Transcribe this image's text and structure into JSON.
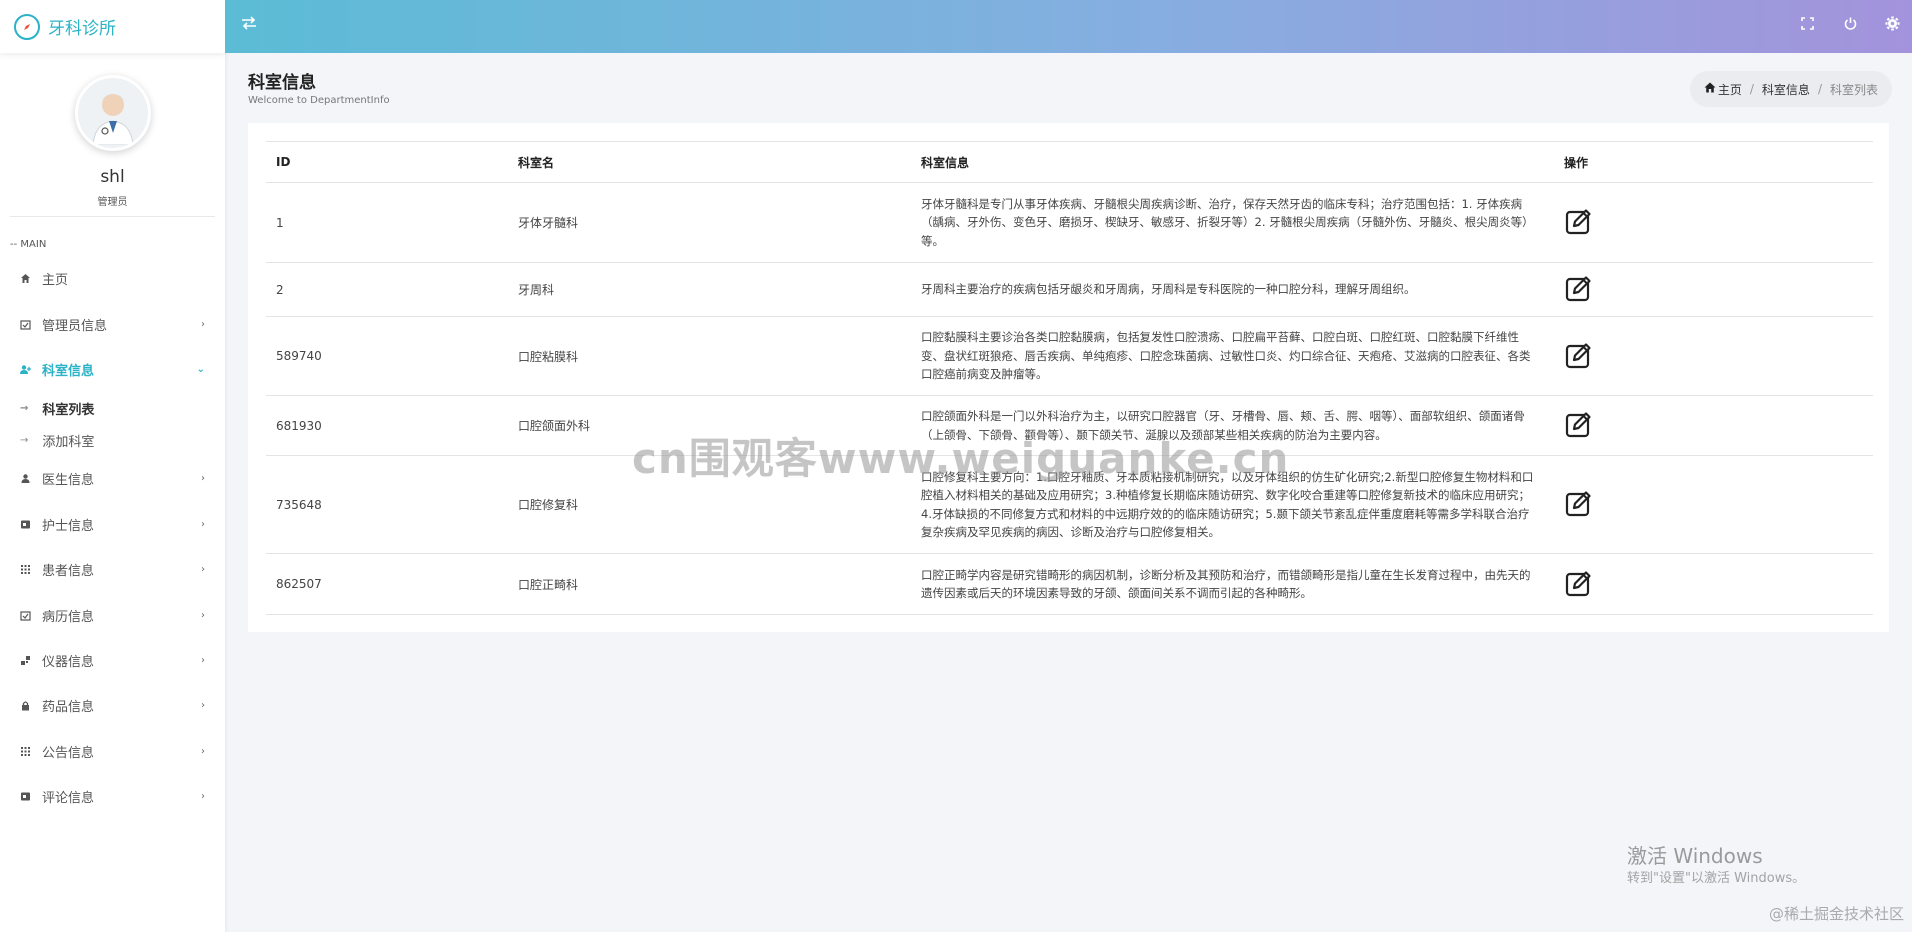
{
  "sidebar": {
    "app_name": "牙科诊所",
    "user_name": "shl",
    "user_role": "管理员",
    "section_label": "-- MAIN",
    "items": [
      {
        "label": "主页",
        "icon": "home-icon",
        "has_chevron": false
      },
      {
        "label": "管理员信息",
        "icon": "calendar-check-icon",
        "has_chevron": true
      },
      {
        "label": "科室信息",
        "icon": "user-plus-icon",
        "has_chevron": true,
        "active": true
      },
      {
        "label": "医生信息",
        "icon": "user-icon",
        "has_chevron": true
      },
      {
        "label": "护士信息",
        "icon": "id-card-icon",
        "has_chevron": true
      },
      {
        "label": "患者信息",
        "icon": "grid-icon",
        "has_chevron": true
      },
      {
        "label": "病历信息",
        "icon": "calendar-check-icon",
        "has_chevron": true
      },
      {
        "label": "仪器信息",
        "icon": "blocks-icon",
        "has_chevron": true
      },
      {
        "label": "药品信息",
        "icon": "lock-icon",
        "has_chevron": true
      },
      {
        "label": "公告信息",
        "icon": "grid-icon",
        "has_chevron": true
      },
      {
        "label": "评论信息",
        "icon": "id-card-icon",
        "has_chevron": true
      }
    ],
    "sub_items": [
      "科室列表",
      "添加科室"
    ]
  },
  "page": {
    "title": "科室信息",
    "subtitle": "Welcome to DepartmentInfo"
  },
  "breadcrumb": {
    "home": "主页",
    "parent": "科室信息",
    "current": "科室列表"
  },
  "table": {
    "columns": [
      "ID",
      "科室名",
      "科室信息",
      "操作"
    ],
    "rows": [
      {
        "id": "1",
        "name": "牙体牙髓科",
        "info": "牙体牙髓科是专门从事牙体疾病、牙髓根尖周疾病诊断、治疗，保存天然牙齿的临床专科；治疗范围包括：1. 牙体疾病（龋病、牙外伤、变色牙、磨损牙、楔缺牙、敏感牙、折裂牙等）2. 牙髓根尖周疾病（牙髓外伤、牙髓炎、根尖周炎等）等。"
      },
      {
        "id": "2",
        "name": "牙周科",
        "info": "牙周科主要治疗的疾病包括牙龈炎和牙周病，牙周科是专科医院的一种口腔分科，理解牙周组织。"
      },
      {
        "id": "589740",
        "name": "口腔粘膜科",
        "info": "口腔黏膜科主要诊治各类口腔黏膜病，包括复发性口腔溃疡、口腔扁平苔藓、口腔白斑、口腔红斑、口腔黏膜下纤维性变、盘状红斑狼疮、唇舌疾病、单纯疱疹、口腔念珠菌病、过敏性口炎、灼口综合征、天疱疮、艾滋病的口腔表征、各类口腔癌前病变及肿瘤等。"
      },
      {
        "id": "681930",
        "name": "口腔颌面外科",
        "info": "口腔颌面外科是一门以外科治疗为主，以研究口腔器官（牙、牙槽骨、唇、颊、舌、腭、咽等）、面部软组织、颌面诸骨（上颌骨、下颌骨、颧骨等）、颞下颌关节、涎腺以及颈部某些相关疾病的防治为主要内容。"
      },
      {
        "id": "735648",
        "name": "口腔修复科",
        "info": "口腔修复科主要方向：1.口腔牙釉质、牙本质粘接机制研究，以及牙体组织的仿生矿化研究;2.新型口腔修复生物材料和口腔植入材料相关的基础及应用研究；3.种植修复长期临床随访研究、数字化咬合重建等口腔修复新技术的临床应用研究；4.牙体缺损的不同修复方式和材料的中远期疗效的的临床随访研究；5.颞下颌关节紊乱症伴重度磨耗等需多学科联合治疗复杂疾病及罕见疾病的病因、诊断及治疗与口腔修复相关。"
      },
      {
        "id": "862507",
        "name": "口腔正畸科",
        "info": "口腔正畸学内容是研究错畸形的病因机制，诊断分析及其预防和治疗，而错颌畸形是指儿童在生长发育过程中，由先天的遗传因素或后天的环境因素导致的牙颌、颌面间关系不调而引起的各种畸形。"
      }
    ]
  },
  "watermarks": {
    "center": "cn围观客www.weiguanke.cn",
    "windows_title": "激活 Windows",
    "windows_sub": "转到\"设置\"以激活 Windows。",
    "footer": "@稀土掘金技术社区"
  },
  "colors": {
    "accent": "#2ab3c7",
    "header_start": "#5bbcd6",
    "header_end": "#a393dc"
  }
}
